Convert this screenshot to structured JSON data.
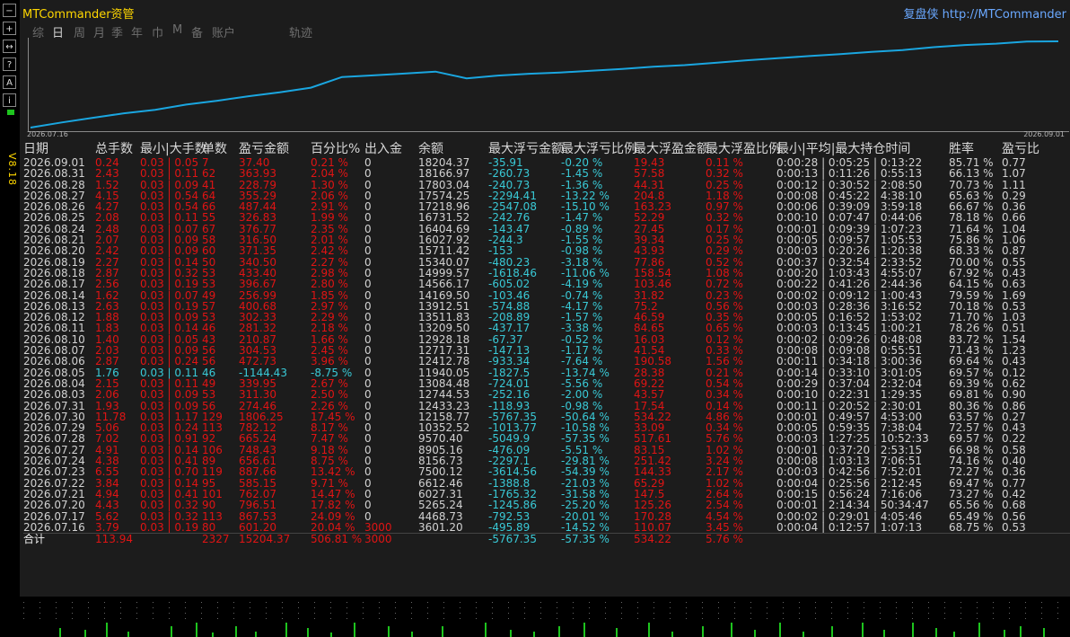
{
  "app_title": "MTCommander资管",
  "brand": "复盘侠 http://MTCommander",
  "version": "V8.18",
  "left_toolbar": [
    "+",
    "↔",
    "?",
    "A",
    "ℹ"
  ],
  "tabs": [
    {
      "label": "综",
      "active": false
    },
    {
      "label": "日",
      "active": true
    },
    {
      "label": "周",
      "active": false
    },
    {
      "label": "月",
      "active": false
    },
    {
      "label": "季",
      "active": false
    },
    {
      "label": "年",
      "active": false
    },
    {
      "label": "巾",
      "active": false
    },
    {
      "label": "M",
      "active": false
    },
    {
      "label": "备",
      "active": false
    },
    {
      "label": "账户",
      "active": false
    },
    {
      "label": "轨迹",
      "active": false
    }
  ],
  "chart_data": {
    "type": "line",
    "x_start_label": "2026.07.16",
    "x_end_label": "2026.09.01",
    "line_color": "#1aa6e0",
    "x": [
      "2026.07.16",
      "2026.07.17",
      "2026.07.20",
      "2026.07.21",
      "2026.07.22",
      "2026.07.23",
      "2026.07.24",
      "2026.07.27",
      "2026.07.28",
      "2026.07.29",
      "2026.07.30",
      "2026.07.31",
      "2026.08.03",
      "2026.08.04",
      "2026.08.05",
      "2026.08.06",
      "2026.08.07",
      "2026.08.10",
      "2026.08.11",
      "2026.08.12",
      "2026.08.13",
      "2026.08.14",
      "2026.08.17",
      "2026.08.18",
      "2026.08.19",
      "2026.08.20",
      "2026.08.21",
      "2026.08.24",
      "2026.08.25",
      "2026.08.26",
      "2026.08.27",
      "2026.08.28",
      "2026.08.31",
      "2026.09.01"
    ],
    "values": [
      3601.2,
      4468.73,
      5265.24,
      6027.31,
      6612.46,
      7500.12,
      8156.73,
      8905.16,
      9570.4,
      10352.52,
      12158.77,
      12433.23,
      12744.53,
      13084.48,
      11940.05,
      12412.78,
      12717.31,
      12928.18,
      13209.5,
      13511.83,
      13912.51,
      14169.5,
      14566.17,
      14999.57,
      15340.07,
      15711.42,
      16027.92,
      16404.69,
      16731.52,
      17218.96,
      17574.25,
      17803.04,
      18166.97,
      18204.37
    ]
  },
  "table": {
    "headers": [
      "日期",
      "总手数",
      "最小|大手数",
      "单数",
      "盈亏金额",
      "百分比%",
      "出入金",
      "余额",
      "最大浮亏金额",
      "最大浮亏比例",
      "最大浮盈金额",
      "最大浮盈比例",
      "最小|平均|最大持仓时间",
      "胜率",
      "盈亏比"
    ],
    "rows": [
      [
        "2026.09.01",
        "0.24",
        "0.03 | 0.05",
        "7",
        "37.40",
        "0.21 %",
        "0",
        "18204.37",
        "-35.91",
        "-0.20 %",
        "19.43",
        "0.11 %",
        "0:00:28 | 0:05:25 | 0:13:22",
        "85.71 %",
        "0.77"
      ],
      [
        "2026.08.31",
        "2.43",
        "0.03 | 0.11",
        "62",
        "363.93",
        "2.04 %",
        "0",
        "18166.97",
        "-260.73",
        "-1.45 %",
        "57.58",
        "0.32 %",
        "0:00:13 | 0:11:26 | 0:55:13",
        "66.13 %",
        "1.07"
      ],
      [
        "2026.08.28",
        "1.52",
        "0.03 | 0.09",
        "41",
        "228.79",
        "1.30 %",
        "0",
        "17803.04",
        "-240.73",
        "-1.36 %",
        "44.31",
        "0.25 %",
        "0:00:12 | 0:30:52 | 2:08:50",
        "70.73 %",
        "1.11"
      ],
      [
        "2026.08.27",
        "4.15",
        "0.03 | 0.54",
        "64",
        "355.29",
        "2.06 %",
        "0",
        "17574.25",
        "-2294.41",
        "-13.22 %",
        "204.8",
        "1.18 %",
        "0:00:08 | 0:45:22 | 4:38:10",
        "65.63 %",
        "0.29"
      ],
      [
        "2026.08.26",
        "4.27",
        "0.03 | 0.54",
        "66",
        "487.44",
        "2.91 %",
        "0",
        "17218.96",
        "-2547.08",
        "-15.10 %",
        "163.23",
        "0.97 %",
        "0:00:06 | 0:39:09 | 3:59:18",
        "66.67 %",
        "0.36"
      ],
      [
        "2026.08.25",
        "2.08",
        "0.03 | 0.11",
        "55",
        "326.83",
        "1.99 %",
        "0",
        "16731.52",
        "-242.76",
        "-1.47 %",
        "52.29",
        "0.32 %",
        "0:00:10 | 0:07:47 | 0:44:06",
        "78.18 %",
        "0.66"
      ],
      [
        "2026.08.24",
        "2.48",
        "0.03 | 0.07",
        "67",
        "376.77",
        "2.35 %",
        "0",
        "16404.69",
        "-143.47",
        "-0.89 %",
        "27.45",
        "0.17 %",
        "0:00:01 | 0:09:39 | 1:07:23",
        "71.64 %",
        "1.04"
      ],
      [
        "2026.08.21",
        "2.07",
        "0.03 | 0.09",
        "58",
        "316.50",
        "2.01 %",
        "0",
        "16027.92",
        "-244.3",
        "-1.55 %",
        "39.34",
        "0.25 %",
        "0:00:05 | 0:09:57 | 1:05:53",
        "75.86 %",
        "1.06"
      ],
      [
        "2026.08.20",
        "2.42",
        "0.03 | 0.09",
        "60",
        "371.35",
        "2.42 %",
        "0",
        "15711.42",
        "-153",
        "-0.98 %",
        "43.93",
        "0.29 %",
        "0:00:03 | 0:20:26 | 1:20:38",
        "68.33 %",
        "0.87"
      ],
      [
        "2026.08.19",
        "2.27",
        "0.03 | 0.14",
        "50",
        "340.50",
        "2.27 %",
        "0",
        "15340.07",
        "-480.23",
        "-3.18 %",
        "77.86",
        "0.52 %",
        "0:00:37 | 0:32:54 | 2:33:52",
        "70.00 %",
        "0.55"
      ],
      [
        "2026.08.18",
        "2.87",
        "0.03 | 0.32",
        "53",
        "433.40",
        "2.98 %",
        "0",
        "14999.57",
        "-1618.46",
        "-11.06 %",
        "158.54",
        "1.08 %",
        "0:00:20 | 1:03:43 | 4:55:07",
        "67.92 %",
        "0.43"
      ],
      [
        "2026.08.17",
        "2.56",
        "0.03 | 0.19",
        "53",
        "396.67",
        "2.80 %",
        "0",
        "14566.17",
        "-605.02",
        "-4.19 %",
        "103.46",
        "0.72 %",
        "0:00:22 | 0:41:26 | 2:44:36",
        "64.15 %",
        "0.63"
      ],
      [
        "2026.08.14",
        "1.62",
        "0.03 | 0.07",
        "49",
        "256.99",
        "1.85 %",
        "0",
        "14169.50",
        "-103.46",
        "-0.74 %",
        "31.82",
        "0.23 %",
        "0:00:02 | 0:09:12 | 1:00:43",
        "79.59 %",
        "1.69"
      ],
      [
        "2026.08.13",
        "2.63",
        "0.03 | 0.19",
        "57",
        "400.68",
        "2.97 %",
        "0",
        "13912.51",
        "-574.88",
        "-4.17 %",
        "75.2",
        "0.56 %",
        "0:00:03 | 0:28:36 | 3:16:52",
        "70.18 %",
        "0.53"
      ],
      [
        "2026.08.12",
        "1.88",
        "0.03 | 0.09",
        "53",
        "302.33",
        "2.29 %",
        "0",
        "13511.83",
        "-208.89",
        "-1.57 %",
        "46.59",
        "0.35 %",
        "0:00:05 | 0:16:52 | 1:53:02",
        "71.70 %",
        "1.03"
      ],
      [
        "2026.08.11",
        "1.83",
        "0.03 | 0.14",
        "46",
        "281.32",
        "2.18 %",
        "0",
        "13209.50",
        "-437.17",
        "-3.38 %",
        "84.65",
        "0.65 %",
        "0:00:03 | 0:13:45 | 1:00:21",
        "78.26 %",
        "0.51"
      ],
      [
        "2026.08.10",
        "1.40",
        "0.03 | 0.05",
        "43",
        "210.87",
        "1.66 %",
        "0",
        "12928.18",
        "-67.37",
        "-0.52 %",
        "16.03",
        "0.12 %",
        "0:00:02 | 0:09:26 | 0:48:08",
        "83.72 %",
        "1.54"
      ],
      [
        "2026.08.07",
        "2.03",
        "0.03 | 0.09",
        "56",
        "304.53",
        "2.45 %",
        "0",
        "12717.31",
        "-147.13",
        "-1.17 %",
        "41.54",
        "0.33 %",
        "0:00:08 | 0:09:08 | 0:55:51",
        "71.43 %",
        "1.23"
      ],
      [
        "2026.08.06",
        "2.87",
        "0.03 | 0.24",
        "56",
        "472.73",
        "3.96 %",
        "0",
        "12412.78",
        "-933.34",
        "-7.64 %",
        "190.58",
        "1.56 %",
        "0:00:11 | 0:34:18 | 3:00:36",
        "69.64 %",
        "0.43"
      ],
      [
        "2026.08.05",
        "1.76",
        "0.03 | 0.11",
        "46",
        "-1144.43",
        "-8.75 %",
        "0",
        "11940.05",
        "-1827.5",
        "-13.74 %",
        "28.38",
        "0.21 %",
        "0:00:14 | 0:33:10 | 3:01:05",
        "69.57 %",
        "0.12"
      ],
      [
        "2026.08.04",
        "2.15",
        "0.03 | 0.11",
        "49",
        "339.95",
        "2.67 %",
        "0",
        "13084.48",
        "-724.01",
        "-5.56 %",
        "69.22",
        "0.54 %",
        "0:00:29 | 0:37:04 | 2:32:04",
        "69.39 %",
        "0.62"
      ],
      [
        "2026.08.03",
        "2.06",
        "0.03 | 0.09",
        "53",
        "311.30",
        "2.50 %",
        "0",
        "12744.53",
        "-252.16",
        "-2.00 %",
        "43.57",
        "0.34 %",
        "0:00:10 | 0:22:31 | 1:29:35",
        "69.81 %",
        "0.90"
      ],
      [
        "2026.07.31",
        "1.93",
        "0.03 | 0.09",
        "56",
        "274.46",
        "2.26 %",
        "0",
        "12433.23",
        "-118.93",
        "-0.98 %",
        "17.54",
        "0.14 %",
        "0:00:11 | 0:20:52 | 2:30:01",
        "80.36 %",
        "0.86"
      ],
      [
        "2026.07.30",
        "11.78",
        "0.03 | 1.17",
        "129",
        "1806.25",
        "17.45 %",
        "0",
        "12158.77",
        "-5767.35",
        "-50.64 %",
        "534.22",
        "4.86 %",
        "0:00:01 | 0:49:57 | 4:53:00",
        "63.57 %",
        "0.27"
      ],
      [
        "2026.07.29",
        "5.06",
        "0.03 | 0.24",
        "113",
        "782.12",
        "8.17 %",
        "0",
        "10352.52",
        "-1013.77",
        "-10.58 %",
        "33.09",
        "0.34 %",
        "0:00:05 | 0:59:35 | 7:38:04",
        "72.57 %",
        "0.43"
      ],
      [
        "2026.07.28",
        "7.02",
        "0.03 | 0.91",
        "92",
        "665.24",
        "7.47 %",
        "0",
        "9570.40",
        "-5049.9",
        "-57.35 %",
        "517.61",
        "5.76 %",
        "0:00:03 | 1:27:25 | 10:52:33",
        "69.57 %",
        "0.22"
      ],
      [
        "2026.07.27",
        "4.91",
        "0.03 | 0.14",
        "106",
        "748.43",
        "9.18 %",
        "0",
        "8905.16",
        "-476.09",
        "-5.51 %",
        "83.15",
        "1.02 %",
        "0:00:01 | 0:37:20 | 2:53:15",
        "66.98 %",
        "0.58"
      ],
      [
        "2026.07.24",
        "4.38",
        "0.03 | 0.41",
        "89",
        "656.61",
        "8.75 %",
        "0",
        "8156.73",
        "-2297.1",
        "-29.81 %",
        "251.42",
        "3.24 %",
        "0:00:08 | 1:03:13 | 7:06:51",
        "74.16 %",
        "0.40"
      ],
      [
        "2026.07.23",
        "6.55",
        "0.03 | 0.70",
        "119",
        "887.66",
        "13.42 %",
        "0",
        "7500.12",
        "-3614.56",
        "-54.39 %",
        "144.33",
        "2.17 %",
        "0:00:03 | 0:42:56 | 7:52:01",
        "72.27 %",
        "0.36"
      ],
      [
        "2026.07.22",
        "3.84",
        "0.03 | 0.14",
        "95",
        "585.15",
        "9.71 %",
        "0",
        "6612.46",
        "-1388.8",
        "-21.03 %",
        "65.29",
        "1.02 %",
        "0:00:04 | 0:25:56 | 2:12:45",
        "69.47 %",
        "0.77"
      ],
      [
        "2026.07.21",
        "4.94",
        "0.03 | 0.41",
        "101",
        "762.07",
        "14.47 %",
        "0",
        "6027.31",
        "-1765.32",
        "-31.58 %",
        "147.5",
        "2.64 %",
        "0:00:15 | 0:56:24 | 7:16:06",
        "73.27 %",
        "0.42"
      ],
      [
        "2026.07.20",
        "4.43",
        "0.03 | 0.32",
        "90",
        "796.51",
        "17.82 %",
        "0",
        "5265.24",
        "-1245.86",
        "-25.20 %",
        "125.26",
        "2.54 %",
        "0:00:01 | 2:14:34 | 50:34:47",
        "65.56 %",
        "0.68"
      ],
      [
        "2026.07.17",
        "5.62",
        "0.03 | 0.32",
        "113",
        "867.53",
        "24.09 %",
        "0",
        "4468.73",
        "-792.53",
        "-20.01 %",
        "170.28",
        "4.54 %",
        "0:00:02 | 0:29:01 | 4:05:46",
        "65.49 %",
        "0.56"
      ],
      [
        "2026.07.16",
        "3.79",
        "0.03 | 0.19",
        "80",
        "601.20",
        "20.04 %",
        "3000",
        "3601.20",
        "-495.89",
        "-14.52 %",
        "110.07",
        "3.45 %",
        "0:00:04 | 0:12:57 | 1:07:13",
        "68.75 %",
        "0.53"
      ]
    ],
    "highlight_row": "2026.08.05",
    "total": [
      "合计",
      "113.94",
      "",
      "2327",
      "15204.37",
      "506.81 %",
      "3000",
      "",
      "-5767.35",
      "-57.35 %",
      "534.22",
      "5.76 %",
      "",
      "",
      ""
    ]
  },
  "colors": {
    "positive": "#e01414",
    "negative": "#39c9d6",
    "neutral": "#d2d2d2",
    "title": "#ffd700",
    "brand": "#6aa8ff",
    "volume": "#1ec41e"
  },
  "volume_bars": [
    [
      44,
      10
    ],
    [
      72,
      8
    ],
    [
      96,
      16
    ],
    [
      120,
      6
    ],
    [
      168,
      12
    ],
    [
      196,
      16
    ],
    [
      214,
      5
    ],
    [
      240,
      12
    ],
    [
      262,
      6
    ],
    [
      296,
      16
    ],
    [
      320,
      10
    ],
    [
      346,
      5
    ],
    [
      372,
      16
    ],
    [
      410,
      12
    ],
    [
      436,
      6
    ],
    [
      470,
      12
    ],
    [
      518,
      16
    ],
    [
      546,
      8
    ],
    [
      572,
      6
    ],
    [
      600,
      12
    ],
    [
      628,
      16
    ],
    [
      664,
      10
    ],
    [
      700,
      16
    ],
    [
      726,
      6
    ],
    [
      760,
      12
    ],
    [
      792,
      16
    ],
    [
      818,
      8
    ],
    [
      846,
      16
    ],
    [
      872,
      6
    ],
    [
      904,
      12
    ],
    [
      938,
      16
    ],
    [
      962,
      8
    ],
    [
      994,
      16
    ],
    [
      1020,
      10
    ],
    [
      1040,
      6
    ],
    [
      1068,
      16
    ],
    [
      1096,
      8
    ],
    [
      1114,
      12
    ],
    [
      1140,
      10
    ]
  ]
}
